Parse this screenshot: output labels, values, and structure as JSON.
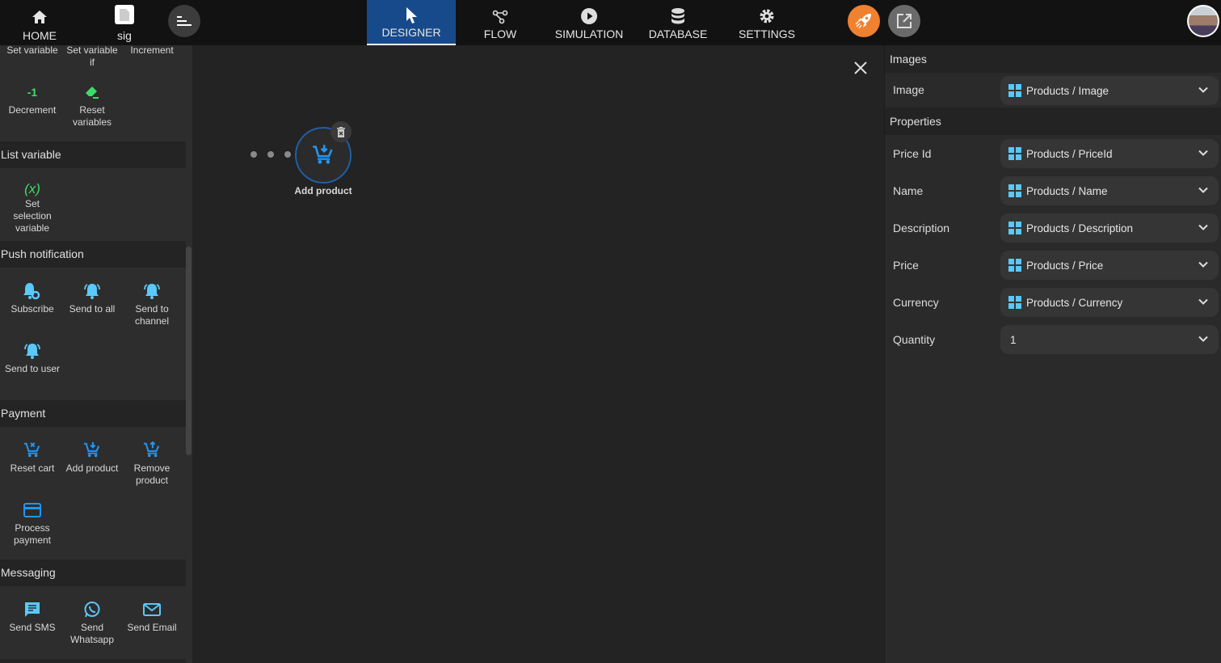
{
  "topbar": {
    "home": "HOME",
    "project": "sig",
    "tabs": [
      {
        "label": "DESIGNER"
      },
      {
        "label": "FLOW"
      },
      {
        "label": "SIMULATION"
      },
      {
        "label": "DATABASE"
      },
      {
        "label": "SETTINGS"
      }
    ],
    "accent": "#174a8b",
    "publish_color": "#f0812f"
  },
  "sidebar": {
    "sections": [
      {
        "title": "Variable",
        "items": [
          {
            "label": "Set variable",
            "icon": "set-variable-icon"
          },
          {
            "label": "Set variable if",
            "icon": "set-variable-if-icon"
          },
          {
            "label": "Increment",
            "icon": "increment-icon"
          },
          {
            "label": "Decrement",
            "icon": "decrement-icon",
            "glyph": "-1"
          },
          {
            "label": "Reset variables",
            "icon": "eraser-icon"
          }
        ]
      },
      {
        "title": "List variable",
        "items": [
          {
            "label": "Set selection variable",
            "icon": "variable-icon",
            "glyph": "(x)"
          }
        ]
      },
      {
        "title": "Push notification",
        "items": [
          {
            "label": "Subscribe",
            "icon": "bell-gear-icon"
          },
          {
            "label": "Send to all",
            "icon": "bell-ring-icon"
          },
          {
            "label": "Send to channel",
            "icon": "bell-ring-icon"
          },
          {
            "label": "Send to user",
            "icon": "bell-ring-icon"
          }
        ]
      },
      {
        "title": "Payment",
        "items": [
          {
            "label": "Reset cart",
            "icon": "cart-remove-icon"
          },
          {
            "label": "Add product",
            "icon": "cart-add-icon"
          },
          {
            "label": "Remove product",
            "icon": "cart-up-icon"
          },
          {
            "label": "Process payment",
            "icon": "credit-card-icon"
          }
        ]
      },
      {
        "title": "Messaging",
        "items": [
          {
            "label": "Send SMS",
            "icon": "sms-icon"
          },
          {
            "label": "Send Whatsapp",
            "icon": "whatsapp-icon"
          },
          {
            "label": "Send Email",
            "icon": "email-icon"
          }
        ]
      },
      {
        "title": "",
        "items": []
      }
    ]
  },
  "canvas": {
    "node_label": "Add product"
  },
  "panel": {
    "images_header": "Images",
    "image_row": {
      "label": "Image",
      "value": "Products / Image"
    },
    "properties_header": "Properties",
    "rows": [
      {
        "label": "Price Id",
        "value": "Products / PriceId",
        "source": true
      },
      {
        "label": "Name",
        "value": "Products / Name",
        "source": true
      },
      {
        "label": "Description",
        "value": "Products / Description",
        "source": true
      },
      {
        "label": "Price",
        "value": "Products / Price",
        "source": true
      },
      {
        "label": "Currency",
        "value": "Products / Currency",
        "source": true
      },
      {
        "label": "Quantity",
        "value": "1",
        "source": false
      }
    ]
  }
}
